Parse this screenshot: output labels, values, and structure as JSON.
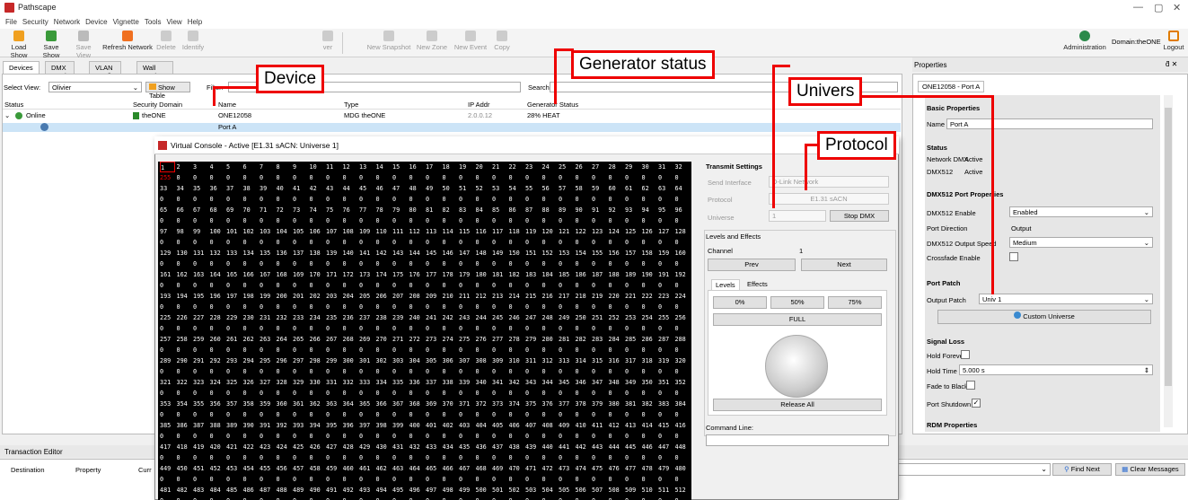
{
  "app": {
    "title": "Pathscape"
  },
  "menu": [
    "File",
    "Security",
    "Network",
    "Device",
    "Vignette",
    "Tools",
    "View",
    "Help"
  ],
  "toolbar": {
    "load_show": "Load Show",
    "save_show": "Save Show",
    "save_view": "Save View",
    "refresh_network": "Refresh Network",
    "delete": "Delete",
    "identify": "Identify",
    "ver": "ver",
    "new_snapshot": "New Snapshot",
    "new_zone": "New Zone",
    "new_event": "New Event",
    "copy": "Copy",
    "administration": "Administration",
    "domain": "Domain:theONE",
    "logout": "Logout"
  },
  "tabs": [
    "Devices",
    "DMX Patch",
    "VLAN Config",
    "Wall Stations"
  ],
  "select_view": {
    "label": "Select View:",
    "value": "Olivier",
    "show_table": "Show Table",
    "filter": "Filter:",
    "search": "Search"
  },
  "table": {
    "headers": [
      "Status",
      "Security Domain",
      "Name",
      "Type",
      "IP Addr",
      "Generator Status"
    ],
    "rows": [
      {
        "status": "Online",
        "domain": "theONE",
        "name": "ONE12058",
        "type": "MDG theONE",
        "ip": "2.0.0.12",
        "gen": "28% HEAT"
      },
      {
        "name": "Port A"
      }
    ]
  },
  "properties": {
    "title": "Properties",
    "tab": "ONE12058 - Port A",
    "basic": "Basic Properties",
    "name_label": "Name",
    "name_value": "Port A",
    "status": "Status",
    "network_dmx": "Network DMX",
    "network_dmx_val": "Active",
    "dmx512": "DMX512",
    "dmx512_val": "Active",
    "port_props": "DMX512 Port Properties",
    "enable_label": "DMX512 Enable",
    "enable_val": "Enabled",
    "direction_label": "Port Direction",
    "direction_val": "Output",
    "speed_label": "DMX512 Output Speed",
    "speed_val": "Medium",
    "crossfade": "Crossfade Enable",
    "port_patch": "Port Patch",
    "output_patch": "Output Patch",
    "output_patch_val": "Univ 1",
    "custom_universe": "Custom Universe",
    "signal_loss": "Signal Loss",
    "hold_forever": "Hold Forever",
    "hold_time": "Hold Time",
    "hold_time_val": "5.000 s",
    "fade_black": "Fade to Black",
    "port_shutdown": "Port Shutdown",
    "rdm": "RDM Properties"
  },
  "vc": {
    "title": "Virtual Console - Active [E1.31 sACN: Universe 1]",
    "transmit": "Transmit Settings",
    "send_if": "Send Interface",
    "send_if_val": "D-Link Network",
    "protocol": "Protocol",
    "protocol_val": "E1.31 sACN",
    "universe": "Universe",
    "universe_val": "1",
    "stop_dmx": "Stop DMX",
    "levels_effects": "Levels and Effects",
    "channel": "Channel",
    "channel_val": "1",
    "prev": "Prev",
    "next": "Next",
    "tab_levels": "Levels",
    "tab_effects": "Effects",
    "p0": "0%",
    "p50": "50%",
    "p75": "75%",
    "full": "FULL",
    "release_all": "Release All",
    "command_line": "Command Line:",
    "first_level": "255"
  },
  "tx": {
    "title": "Transaction Editor",
    "destination": "Destination",
    "property": "Property",
    "current": "Curr",
    "find_next": "Find Next",
    "clear_messages": "Clear Messages"
  },
  "annotations": {
    "device": "Device",
    "generator_status": "Generator status",
    "univers": "Univers",
    "protocol": "Protocol"
  }
}
